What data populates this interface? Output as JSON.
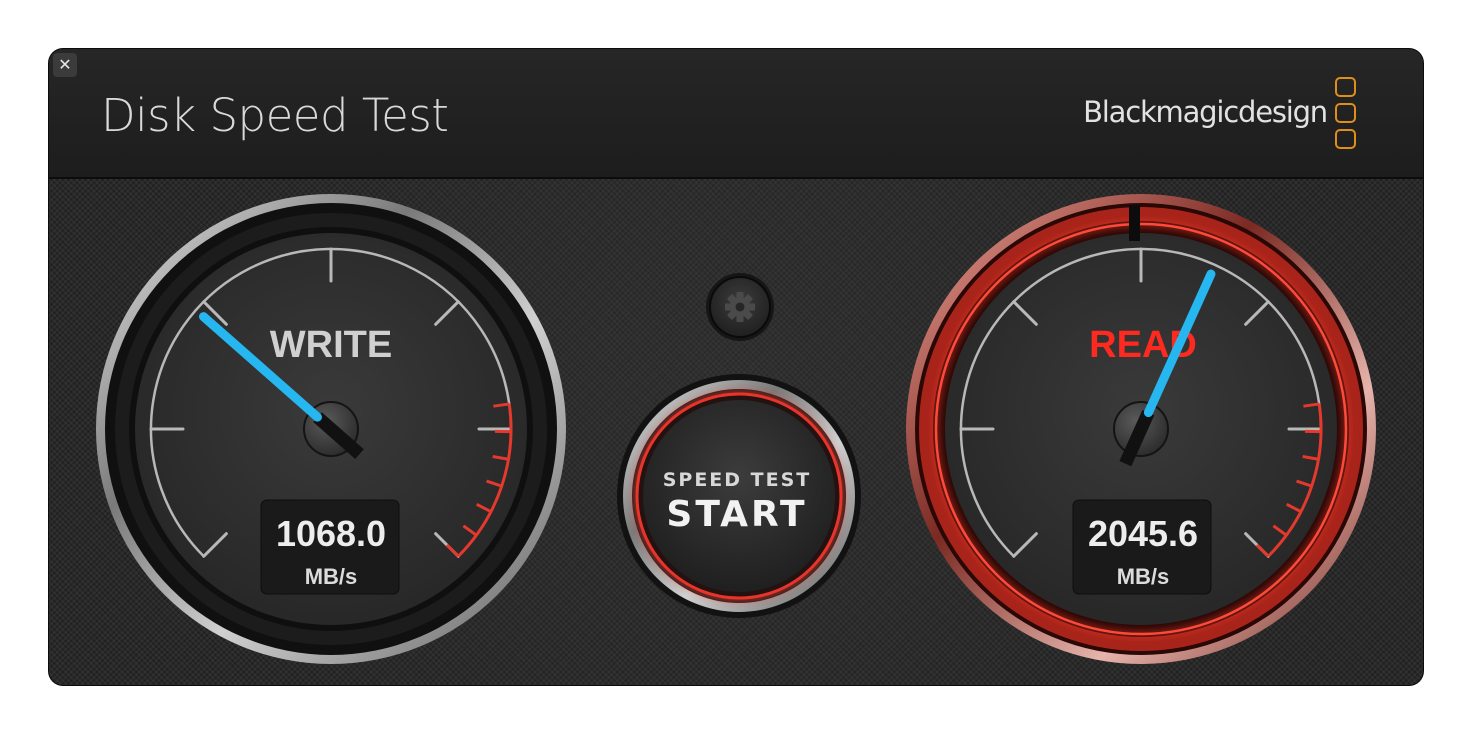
{
  "window": {
    "title": "Disk Speed Test",
    "brand_name": "Blackmagicdesign",
    "brand_color": "#e08e18",
    "close_icon": "close-icon",
    "close_glyph": "✕"
  },
  "settings": {
    "icon": "gear-icon"
  },
  "start_button": {
    "line1": "SPEED TEST",
    "line2": "START",
    "ring_color": "#e3352a"
  },
  "write_gauge": {
    "label": "WRITE",
    "value": "1068.0",
    "unit": "MB/s",
    "needle_fraction": 0.32,
    "active": false,
    "label_color": "#d0d0d0"
  },
  "read_gauge": {
    "label": "READ",
    "value": "2045.6",
    "unit": "MB/s",
    "needle_fraction": 0.59,
    "active": true,
    "label_color": "#ff2a1f"
  },
  "colors": {
    "needle": "#27b7f0",
    "redline": "#e4392c",
    "tick": "#b8b8b8"
  }
}
